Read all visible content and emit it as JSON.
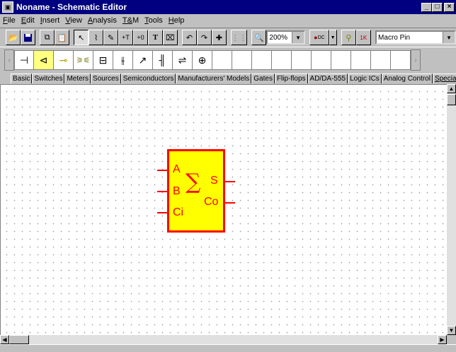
{
  "window": {
    "title": "Noname - Schematic Editor",
    "min": "_",
    "max": "□",
    "close": "×"
  },
  "menu": [
    "File",
    "Edit",
    "Insert",
    "View",
    "Analysis",
    "T&M",
    "Tools",
    "Help"
  ],
  "toolbar": {
    "zoom_value": "200%",
    "macro_pin_value": "Macro Pin",
    "dc_label": "DC"
  },
  "component_tabs": [
    "Basic",
    "Switches",
    "Meters",
    "Sources",
    "Semiconductors",
    "Manufacturers' Models",
    "Gates",
    "Flip-flops",
    "AD/DA-555",
    "Logic ICs",
    "Analog Control",
    "Special"
  ],
  "active_tab": "Special",
  "palette_icons": [
    "resistor-icon",
    "capacitor-yellow-icon",
    "diode-icon",
    "transformer-icon",
    "crystal-icon",
    "variable-capacitor-icon",
    "varicap-icon",
    "battery-icon",
    "rectifier-icon",
    "tube-icon"
  ],
  "schematic": {
    "component": {
      "inputs": [
        "A",
        "B",
        "Ci"
      ],
      "outputs": [
        "S",
        "Co"
      ],
      "symbol": "∑",
      "fill_color": "#ffff00",
      "stroke_color": "#ff0000"
    }
  }
}
